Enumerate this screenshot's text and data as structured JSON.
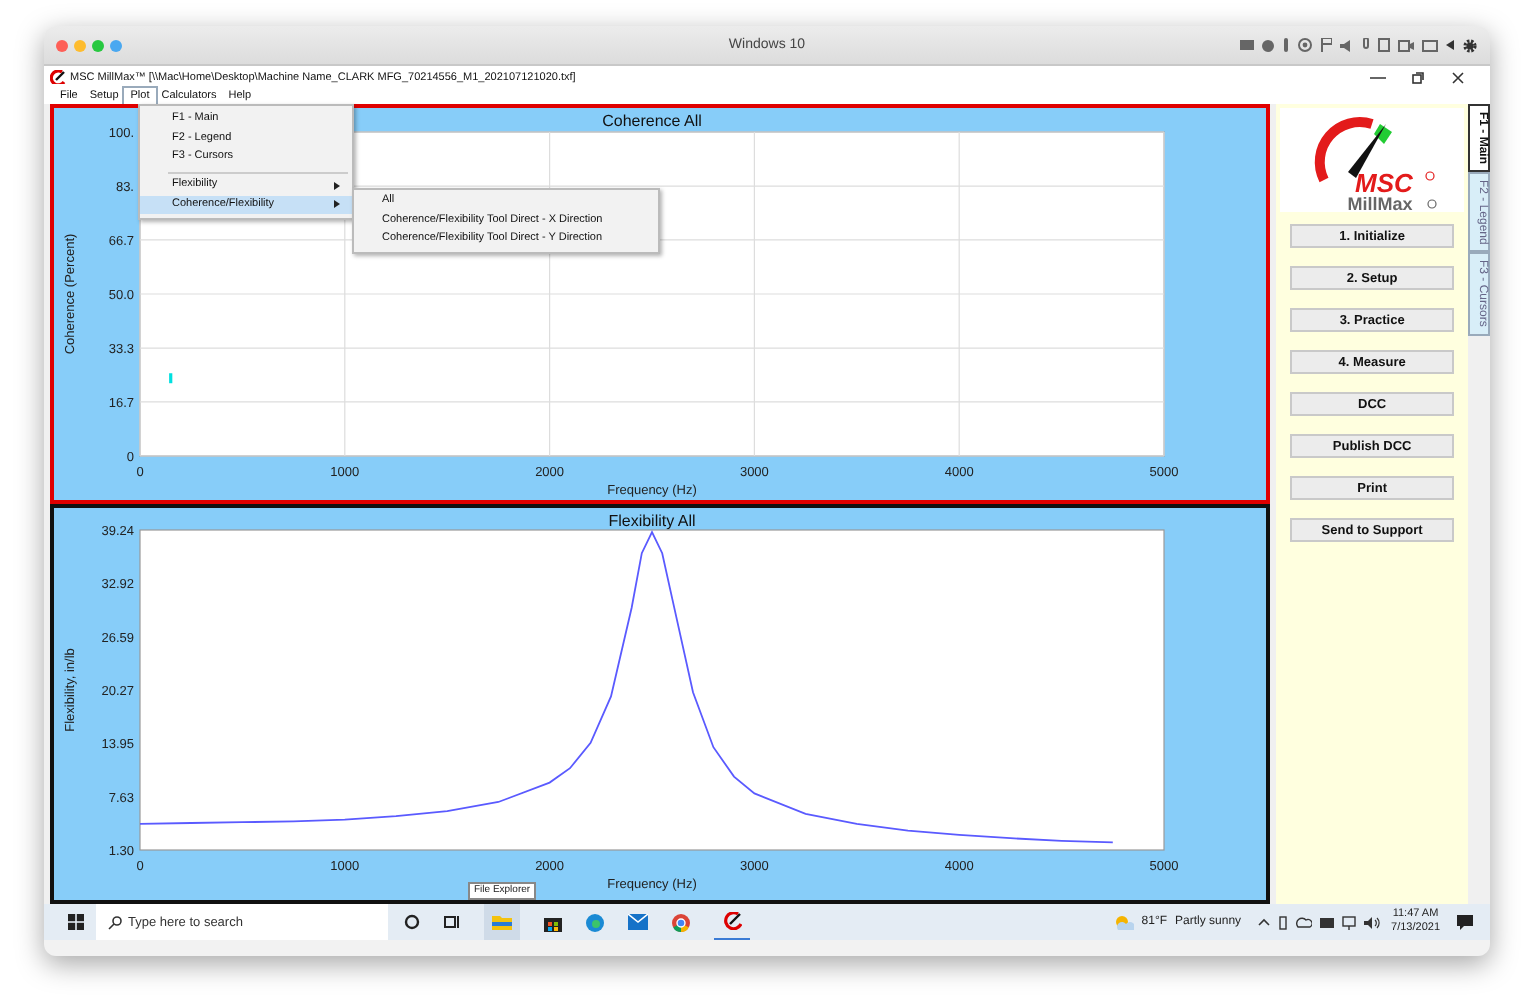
{
  "host_window": {
    "title": "Windows 10"
  },
  "app_window": {
    "title": "MSC MillMax™ [\\\\Mac\\Home\\Desktop\\Machine Name_CLARK MFG_70214556_M1_202107121020.txf]"
  },
  "menu_bar": [
    {
      "label": "File",
      "selected": false
    },
    {
      "label": "Setup",
      "selected": false
    },
    {
      "label": "Plot",
      "selected": true
    },
    {
      "label": "Calculators",
      "selected": false
    },
    {
      "label": "Help",
      "selected": false
    }
  ],
  "open_menu": {
    "items": [
      {
        "kind": "item",
        "label": "F1 - Main",
        "selected": false
      },
      {
        "kind": "item",
        "label": "F2 - Legend",
        "selected": false
      },
      {
        "kind": "item",
        "label": "F3 - Cursors",
        "selected": false
      },
      {
        "kind": "separator"
      },
      {
        "kind": "submenu",
        "label": "Flexibility",
        "selected": false
      },
      {
        "kind": "submenu",
        "label": "Coherence/Flexibility",
        "selected": true
      }
    ]
  },
  "submenu": {
    "items": [
      {
        "label": "All"
      },
      {
        "label": "Coherence/Flexibility Tool Direct - X Direction"
      },
      {
        "label": "Coherence/Flexibility Tool Direct - Y Direction"
      }
    ]
  },
  "charts": [
    {
      "selected": true,
      "chart_data": {
        "type": "scatter",
        "title": "Coherence All",
        "xlabel": "Frequency (Hz)",
        "ylabel": "Coherence (Percent)",
        "grid": true,
        "xlim": [
          0,
          5000
        ],
        "ylim": [
          0,
          100
        ],
        "xticks": [
          0,
          1000,
          2000,
          3000,
          4000,
          5000
        ],
        "yticks": [
          {
            "value": 0,
            "label": "0"
          },
          {
            "value": 16.7,
            "label": "16.7"
          },
          {
            "value": 33.3,
            "label": "33.3"
          },
          {
            "value": 50,
            "label": "50.0"
          },
          {
            "value": 66.7,
            "label": "66.7"
          },
          {
            "value": 83.3,
            "label": "83."
          },
          {
            "value": 100,
            "label": "100."
          }
        ],
        "x": [
          150
        ],
        "series": [
          {
            "color": "#00e0e0",
            "values": [
              24
            ]
          }
        ]
      }
    },
    {
      "selected": false,
      "chart_data": {
        "type": "line",
        "title": "Flexibility All",
        "xlabel": "Frequency (Hz)",
        "ylabel": "Flexibility, in/lb",
        "xlim": [
          0,
          5000
        ],
        "ylim": [
          1.3,
          39.24
        ],
        "xticks": [
          0,
          1000,
          2000,
          3000,
          4000,
          5000
        ],
        "yticks": [
          {
            "value": 1.3,
            "label": "1.30"
          },
          {
            "value": 7.63,
            "label": "7.63"
          },
          {
            "value": 13.95,
            "label": "13.95"
          },
          {
            "value": 20.27,
            "label": "20.27"
          },
          {
            "value": 26.59,
            "label": "26.59"
          },
          {
            "value": 32.92,
            "label": "32.92"
          },
          {
            "value": 39.24,
            "label": "39.24"
          }
        ],
        "x": [
          0,
          250,
          500,
          750,
          1000,
          1250,
          1500,
          1750,
          2000,
          2100,
          2200,
          2300,
          2400,
          2450,
          2500,
          2550,
          2600,
          2700,
          2800,
          2900,
          3000,
          3250,
          3500,
          3750,
          4000,
          4250,
          4500,
          4750
        ],
        "series": [
          {
            "color": "#5a5aff",
            "values": [
              4.4,
              4.5,
              4.6,
              4.7,
              4.9,
              5.3,
              5.9,
              7.0,
              9.3,
              11.0,
              14.0,
              19.5,
              30.0,
              36.5,
              39.0,
              36.5,
              31.0,
              20.0,
              13.5,
              10.0,
              8.0,
              5.6,
              4.4,
              3.6,
              3.1,
              2.7,
              2.4,
              2.2
            ]
          }
        ]
      }
    }
  ],
  "logo": {
    "brand": "MSC",
    "name": "MillMax"
  },
  "side_buttons": [
    "1. Initialize",
    "2. Setup",
    "3. Practice",
    "4. Measure",
    "DCC",
    "Publish DCC",
    "Print",
    "Send to Support"
  ],
  "side_tabs": [
    {
      "label": "F1 - Main",
      "selected": true
    },
    {
      "label": "F2 - Legend",
      "selected": false
    },
    {
      "label": "F3 - Cursors",
      "selected": false
    }
  ],
  "tooltip": "File Explorer",
  "taskbar": {
    "search_placeholder": "Type here to search",
    "temperature": "81°F",
    "weather": "Partly sunny",
    "time": "11:47 AM",
    "date": "7/13/2021"
  }
}
